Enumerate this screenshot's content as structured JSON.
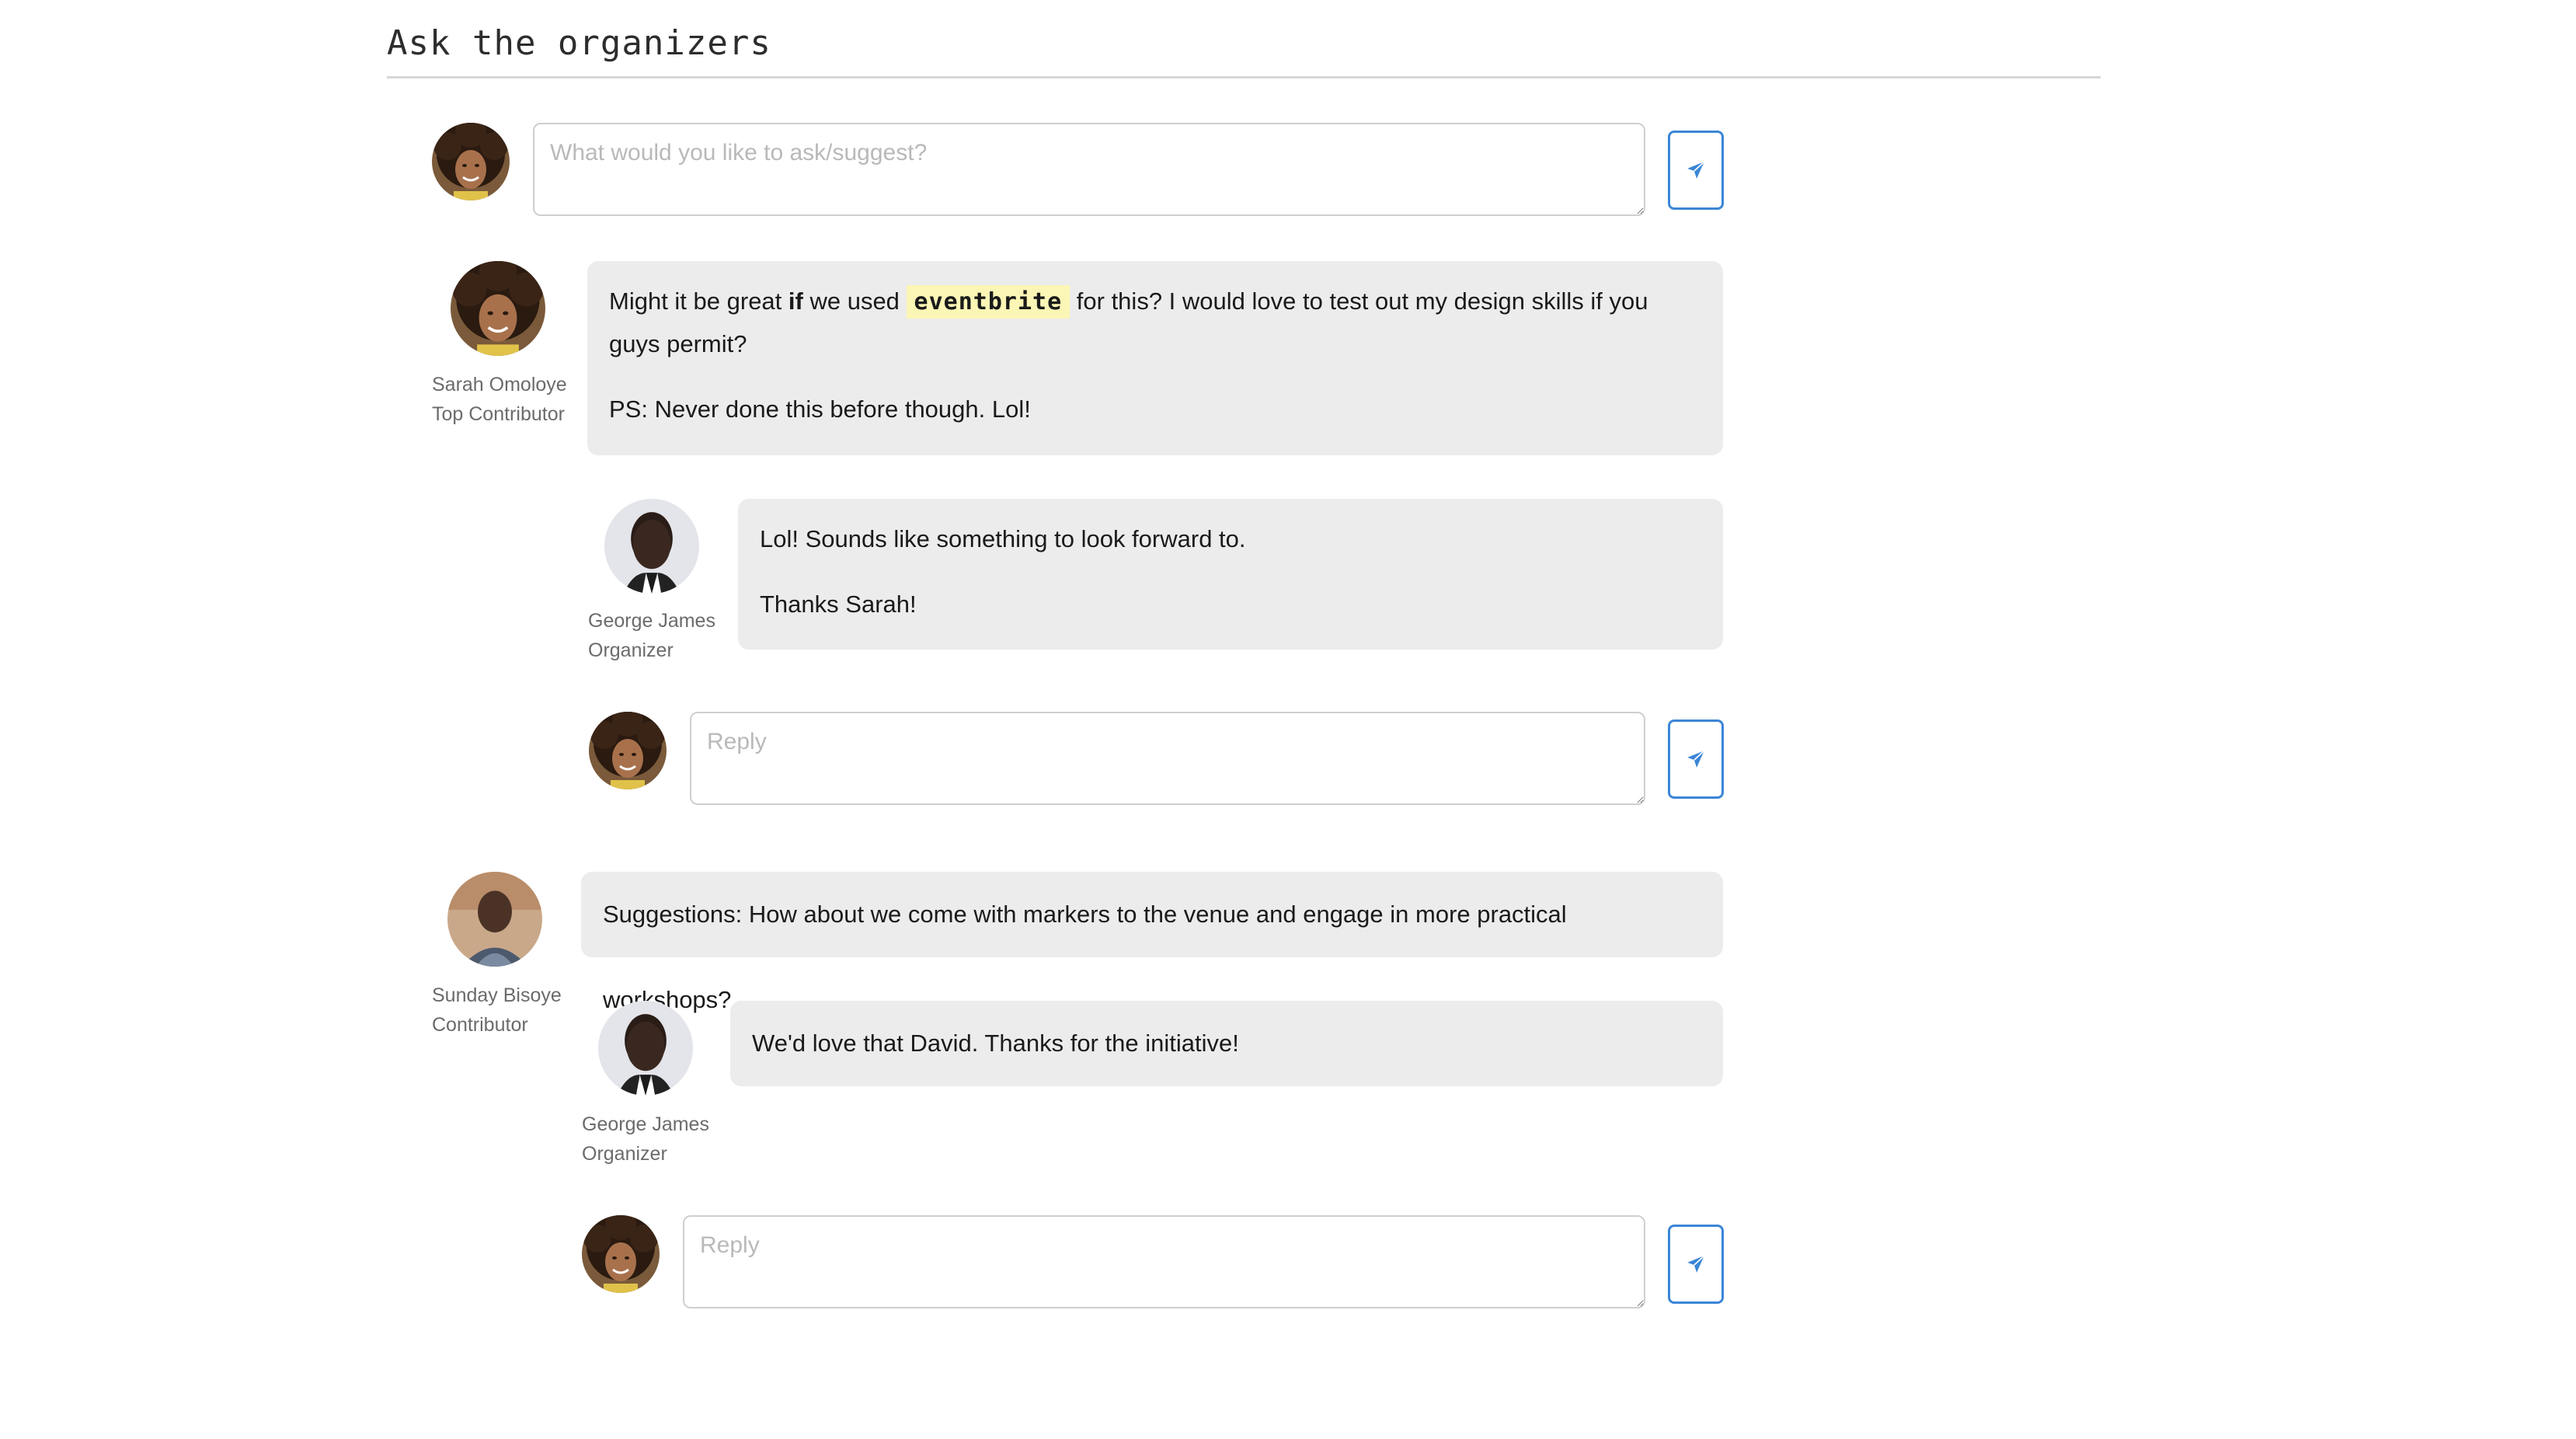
{
  "section": {
    "title": "Ask the organizers"
  },
  "ask_form": {
    "placeholder": "What would you like to ask/suggest?",
    "send_icon": "paper-plane-icon"
  },
  "colors": {
    "accent": "#3b86d6",
    "bubble_bg": "#ececec",
    "code_highlight": "#fbf6b5"
  },
  "threads": [
    {
      "author": {
        "name": "Sarah Omoloye",
        "role": "Top Contributor"
      },
      "message": {
        "line1_a": "Might it be great ",
        "line1_bold": "if",
        "line1_b": " we used ",
        "line1_code": "eventbrite",
        "line1_c": " for this?  I would love to test out my design skills if you",
        "line2": "guys permit?",
        "line3": "PS: Never done this before though. Lol!"
      },
      "replies": [
        {
          "author": {
            "name": "George James",
            "role": "Organizer"
          },
          "paragraphs": [
            "Lol! Sounds like something to look forward to.",
            "Thanks Sarah!"
          ]
        }
      ],
      "reply_form": {
        "placeholder": "Reply"
      }
    },
    {
      "author": {
        "name": "Sunday Bisoye",
        "role": "Contributor"
      },
      "message": {
        "text": "Suggestions: How about we come with markers to the venue and engage in more practical workshops?"
      },
      "replies": [
        {
          "author": {
            "name": "George James",
            "role": "Organizer"
          },
          "paragraphs": [
            "We'd love that David. Thanks for the initiative!"
          ]
        }
      ],
      "reply_form": {
        "placeholder": "Reply"
      }
    }
  ]
}
